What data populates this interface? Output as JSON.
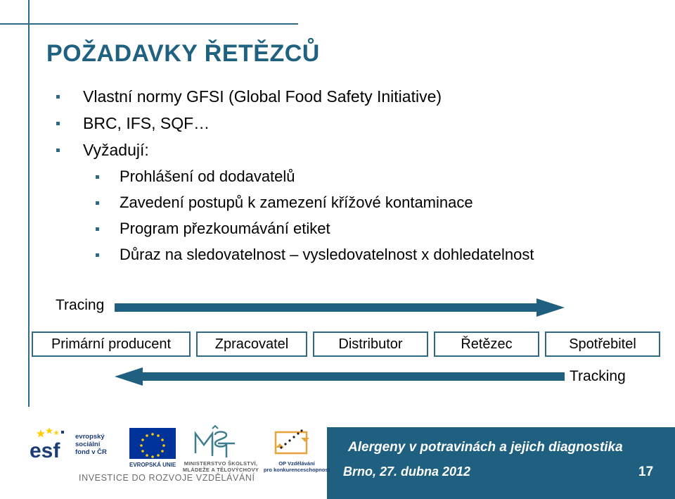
{
  "slide": {
    "title": "POŽADAVKY ŘETĚZCŮ",
    "accent_color": "#1F6180",
    "rule_color": "#2E6A86",
    "footer_band_color": "#1F6080"
  },
  "bullets": {
    "level1": [
      "Vlastní normy GFSI (Global Food Safety Initiative)",
      "BRC, IFS, SQF…",
      "Vyžadují:"
    ],
    "level2": [
      "Prohlášení od dodavatelů",
      "Zavedení postupů k zamezení křížové kontaminace",
      "Program přezkoumávání etiket",
      "Důraz na sledovatelnost – vysledovatelnost x dohledatelnost"
    ]
  },
  "diagram": {
    "tracing_label": "Tracing",
    "tracking_label": "Tracking",
    "arrow_color": "#1F6080",
    "boxes": [
      "Primární producent",
      "Zpracovatel",
      "Distributor",
      "Řetězec",
      "Spotřebitel"
    ]
  },
  "footer": {
    "course_title": "Alergeny v potravinách a jejich diagnostika",
    "place_date": "Brno, 27. dubna 2012",
    "page_number": "17"
  },
  "logos": {
    "esf_line1": "evropský",
    "esf_line2": "sociální",
    "esf_line3": "fond v ČR",
    "eu_caption": "EVROPSKÁ UNIE",
    "msmt_line1": "MINISTERSTVO ŠKOLSTVÍ,",
    "msmt_line2": "MLÁDEŽE A TĚLOVÝCHOVY",
    "op_line1": "OP Vzdělávání",
    "op_line2": "pro konkurenceschopnost",
    "investice": "INVESTICE DO ROZVOJE VZDĚLÁVÁNÍ"
  }
}
